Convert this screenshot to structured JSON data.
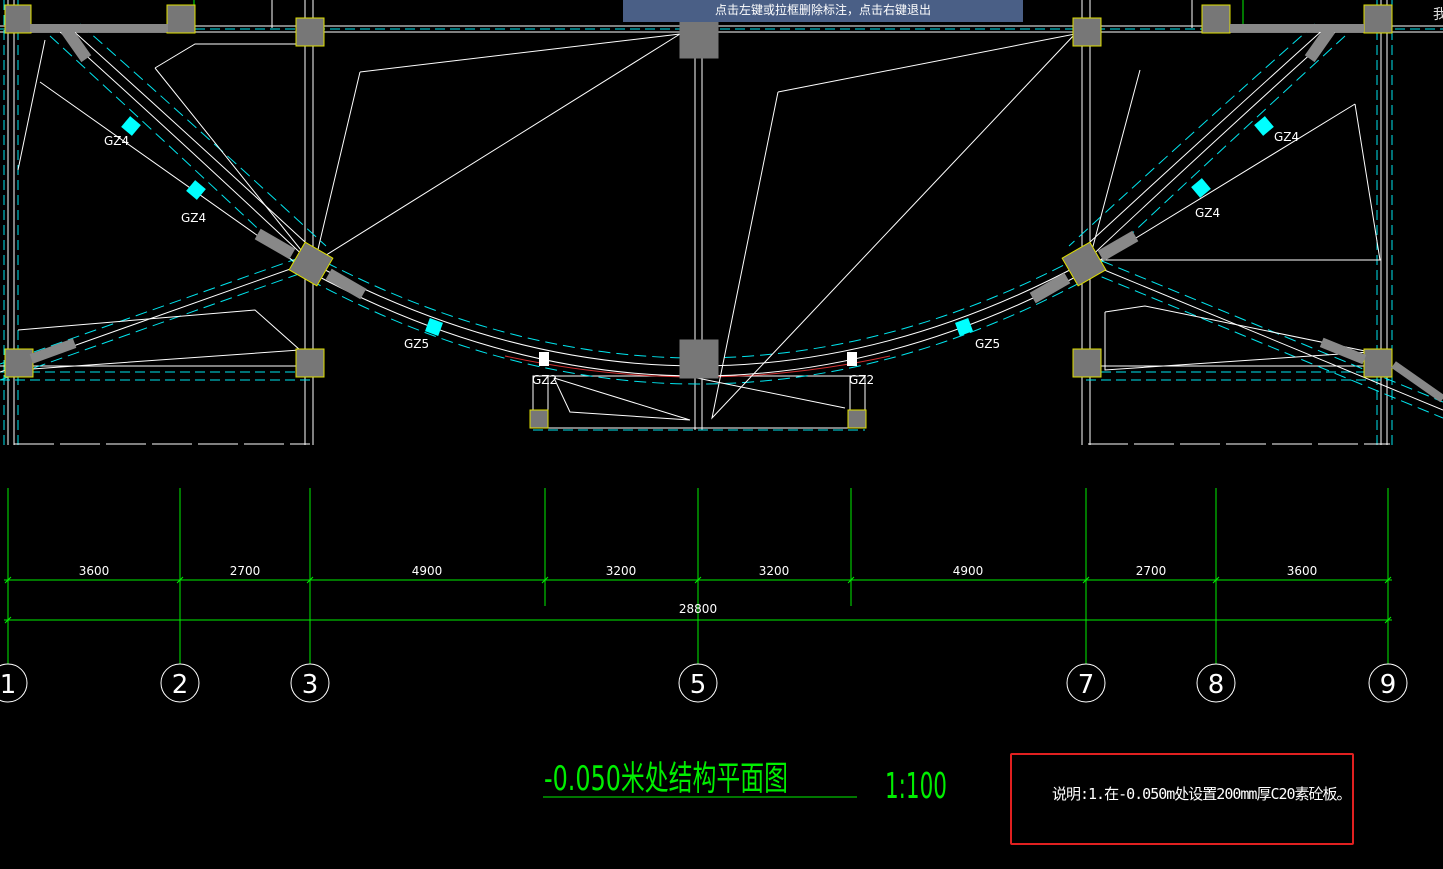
{
  "toolbar_hint": "点击左键或拉框删除标注，点击右键退出",
  "edge_text": "我",
  "drawing": {
    "column_labels": [
      {
        "id": "gz4-upper-left",
        "text": "GZ4"
      },
      {
        "id": "gz4-lower-left",
        "text": "GZ4"
      },
      {
        "id": "gz5-left",
        "text": "GZ5"
      },
      {
        "id": "gz2-left",
        "text": "GZ2"
      },
      {
        "id": "gz2-right",
        "text": "GZ2"
      },
      {
        "id": "gz5-right",
        "text": "GZ5"
      },
      {
        "id": "gz4-lower-right",
        "text": "GZ4"
      },
      {
        "id": "gz4-upper-right",
        "text": "GZ4"
      }
    ],
    "dimensions": [
      "3600",
      "2700",
      "4900",
      "3200",
      "3200",
      "4900",
      "2700",
      "3600"
    ],
    "total_dimension": "28800",
    "axis_labels": [
      "1",
      "2",
      "3",
      "5",
      "7",
      "8",
      "9"
    ],
    "title": "-0.050米处结构平面图",
    "scale": "1:100",
    "note": "说明:1.在-0.050m处设置200mm厚C20素砼板。"
  },
  "colors": {
    "background": "#000000",
    "axis_green": "#00ee00",
    "beam_cyan": "#00e5ee",
    "column_cyan": "#00ffff",
    "column_gray": "#777777",
    "column_outline": "#e0e000",
    "wall_white": "#ffffff",
    "banner": "#4a5f86",
    "note_border": "#e02020"
  }
}
